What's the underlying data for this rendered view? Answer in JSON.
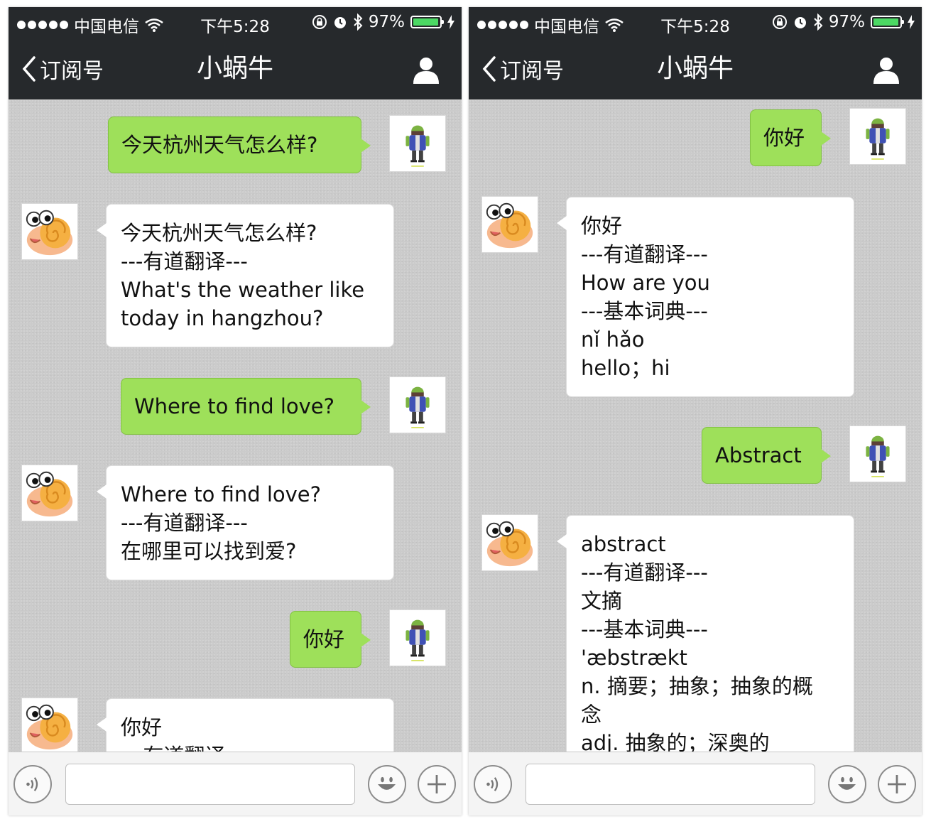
{
  "status_bar": {
    "carrier": "中国电信",
    "time": "下午5:28",
    "battery": "97%",
    "battery_level": 0.97
  },
  "nav": {
    "back_label": "订阅号",
    "title": "小蜗牛"
  },
  "left_screen": {
    "messages": [
      {
        "from": "me",
        "text": "今天杭州天气怎么样?"
      },
      {
        "from": "bot",
        "lines": [
          "今天杭州天气怎么样?",
          "---有道翻译---",
          "What's the weather like",
          "today in hangzhou?"
        ]
      },
      {
        "from": "me",
        "text": "Where to find love?"
      },
      {
        "from": "bot",
        "lines": [
          "Where to find love?",
          "---有道翻译---",
          "在哪里可以找到爱?"
        ]
      },
      {
        "from": "me",
        "text": "你好"
      },
      {
        "from": "bot",
        "lines": [
          "你好",
          "---有道翻译---"
        ]
      }
    ]
  },
  "right_screen": {
    "messages": [
      {
        "from": "me",
        "text": "你好"
      },
      {
        "from": "bot",
        "lines": [
          "你好",
          "---有道翻译---",
          "How are you",
          "---基本词典---",
          "nǐ hǎo",
          "hello；hi"
        ]
      },
      {
        "from": "me",
        "text": "Abstract"
      },
      {
        "from": "bot",
        "lines": [
          "abstract",
          "---有道翻译---",
          "文摘",
          "---基本词典---",
          "'æbstrækt",
          "n. 摘要；抽象；抽象的概",
          "念",
          "adj. 抽象的；深奥的"
        ]
      }
    ]
  },
  "icons": {
    "back": "chevron-left-icon",
    "profile": "person-icon",
    "voice": "voice-icon",
    "emoji": "smiley-icon",
    "add": "plus-icon",
    "user_avatar": "android-figure-avatar",
    "bot_avatar": "snail-avatar"
  },
  "colors": {
    "nav_bg": "#26292c",
    "sent_bubble": "#9ee05a",
    "received_bubble": "#ffffff",
    "chat_bg": "#cbcbcb",
    "battery_fill": "#4cd964"
  }
}
